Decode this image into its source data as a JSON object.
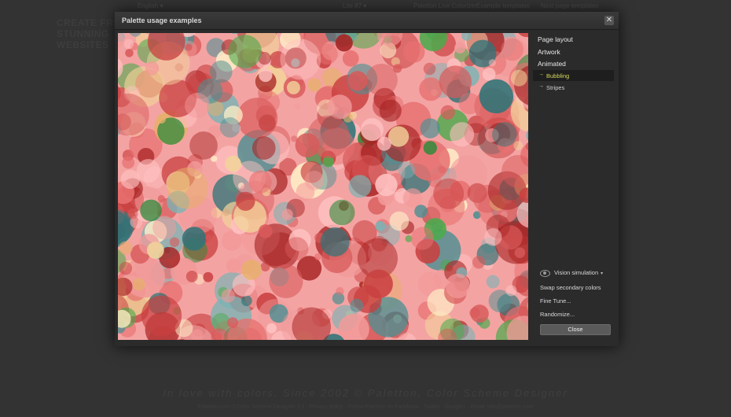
{
  "background": {
    "topbar": {
      "language": "English ▾",
      "version": "Lite 87 ▾",
      "live_colorizer": "Paletton Live Colorizer",
      "extra1": "Example templates",
      "extra2": "Next page templates"
    },
    "logo": {
      "line1": "CREATE FREE",
      "line2": "STUNNING",
      "line3": "WEBSITES"
    },
    "footer_tagline": "In love with colors. Since 2002 © Paletton, Color Scheme Designer",
    "footer_links": "Paletton.com © Color Scheme Designer 3.1 · Privacy policy · Follow Paletton on Facebook · Twitter · Google+ · Email: info@paletton.com"
  },
  "modal": {
    "title": "Palette usage examples",
    "close_icon": "close-icon",
    "menu": {
      "page_layout": "Page layout",
      "artwork": "Artwork",
      "animated": "Animated",
      "sub_items": [
        {
          "arrow": "→",
          "label": "Bubbling",
          "active": true
        },
        {
          "arrow": "→",
          "label": "Stripes",
          "active": false
        }
      ]
    },
    "controls": {
      "vision_icon": "eye-icon",
      "vision_simulation": "Vision simulation",
      "vision_caret": "▾",
      "swap_secondary": "Swap secondary colors",
      "fine_tune": "Fine Tune...",
      "randomize": "Randomize...",
      "close": "Close"
    }
  },
  "palette": {
    "background": "#f4a3a3",
    "reds": [
      "#e87070",
      "#c94040",
      "#a82525",
      "#f29a9a",
      "#ffc2c2",
      "#d85a5a"
    ],
    "teals": [
      "#4e8f92",
      "#2f7478",
      "#7ab3b5"
    ],
    "greens": [
      "#4caa4c",
      "#2e8a3a"
    ],
    "yellows": [
      "#f2d39a",
      "#e6b06a",
      "#fff0c8"
    ]
  }
}
